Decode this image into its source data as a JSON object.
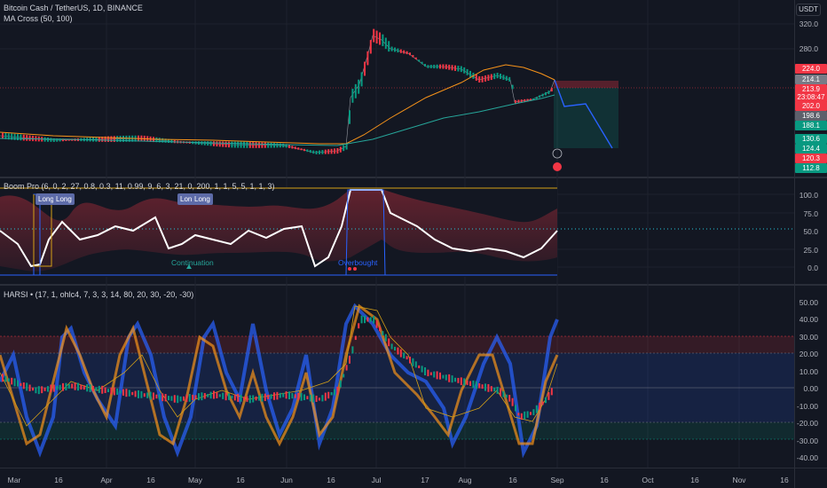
{
  "header": {
    "symbol_line": "Bitcoin Cash / TetherUS, 1D, BINANCE",
    "indicator_line": "MA Cross (50, 100)",
    "currency_button": "USDT"
  },
  "panes": {
    "boom": {
      "legend": "Boom Pro (6, 0, 2, 27, 0.8, 0.3, 11, 0.99, 9, 6, 3, 21, 0, 200, 1, 1, 5, 5, 1, 1, 3)"
    },
    "harsi": {
      "legend": "HARSI • (17, 1, ohlc4, 7, 3, 3, 14, 80, 20, 30, -20, -30)"
    }
  },
  "price_axis": {
    "ticks": [
      "320.0",
      "280.0"
    ],
    "tags": [
      {
        "label": "224.0",
        "color": "#f23645"
      },
      {
        "label": "214.1",
        "color": "#787b86"
      },
      {
        "label": "213.9",
        "color": "#f23645"
      },
      {
        "label": "23:08:47",
        "color": "#f23645"
      },
      {
        "label": "202.0",
        "color": "#f23645"
      },
      {
        "label": "198.6",
        "color": "#5d606b"
      },
      {
        "label": "188.1",
        "color": "#089981"
      },
      {
        "label": "130.6",
        "color": "#089981"
      },
      {
        "label": "124.4",
        "color": "#089981"
      },
      {
        "label": "120.3",
        "color": "#f23645"
      },
      {
        "label": "112.8",
        "color": "#089981"
      }
    ]
  },
  "boom_axis": [
    "100.0",
    "75.0",
    "50.0",
    "25.0",
    "0.0"
  ],
  "harsi_axis": [
    "50.00",
    "40.00",
    "30.00",
    "20.00",
    "10.00",
    "0.00",
    "-10.00",
    "-20.00",
    "-30.00",
    "-40.00"
  ],
  "time_axis": [
    "Mar",
    "16",
    "Apr",
    "16",
    "May",
    "16",
    "Jun",
    "16",
    "Jul",
    "17",
    "Aug",
    "16",
    "Sep",
    "16",
    "Oct",
    "16",
    "Nov",
    "16"
  ],
  "annotations": {
    "long1": "Long",
    "long2": "Long",
    "long3": "Long",
    "long4": "Long",
    "continuation": "Continuation",
    "overbought": "Overbought"
  },
  "colors": {
    "background": "#131722",
    "up": "#089981",
    "down": "#f23645",
    "ma_fast": "#f7931a",
    "ma_slow": "#26a69a"
  }
}
